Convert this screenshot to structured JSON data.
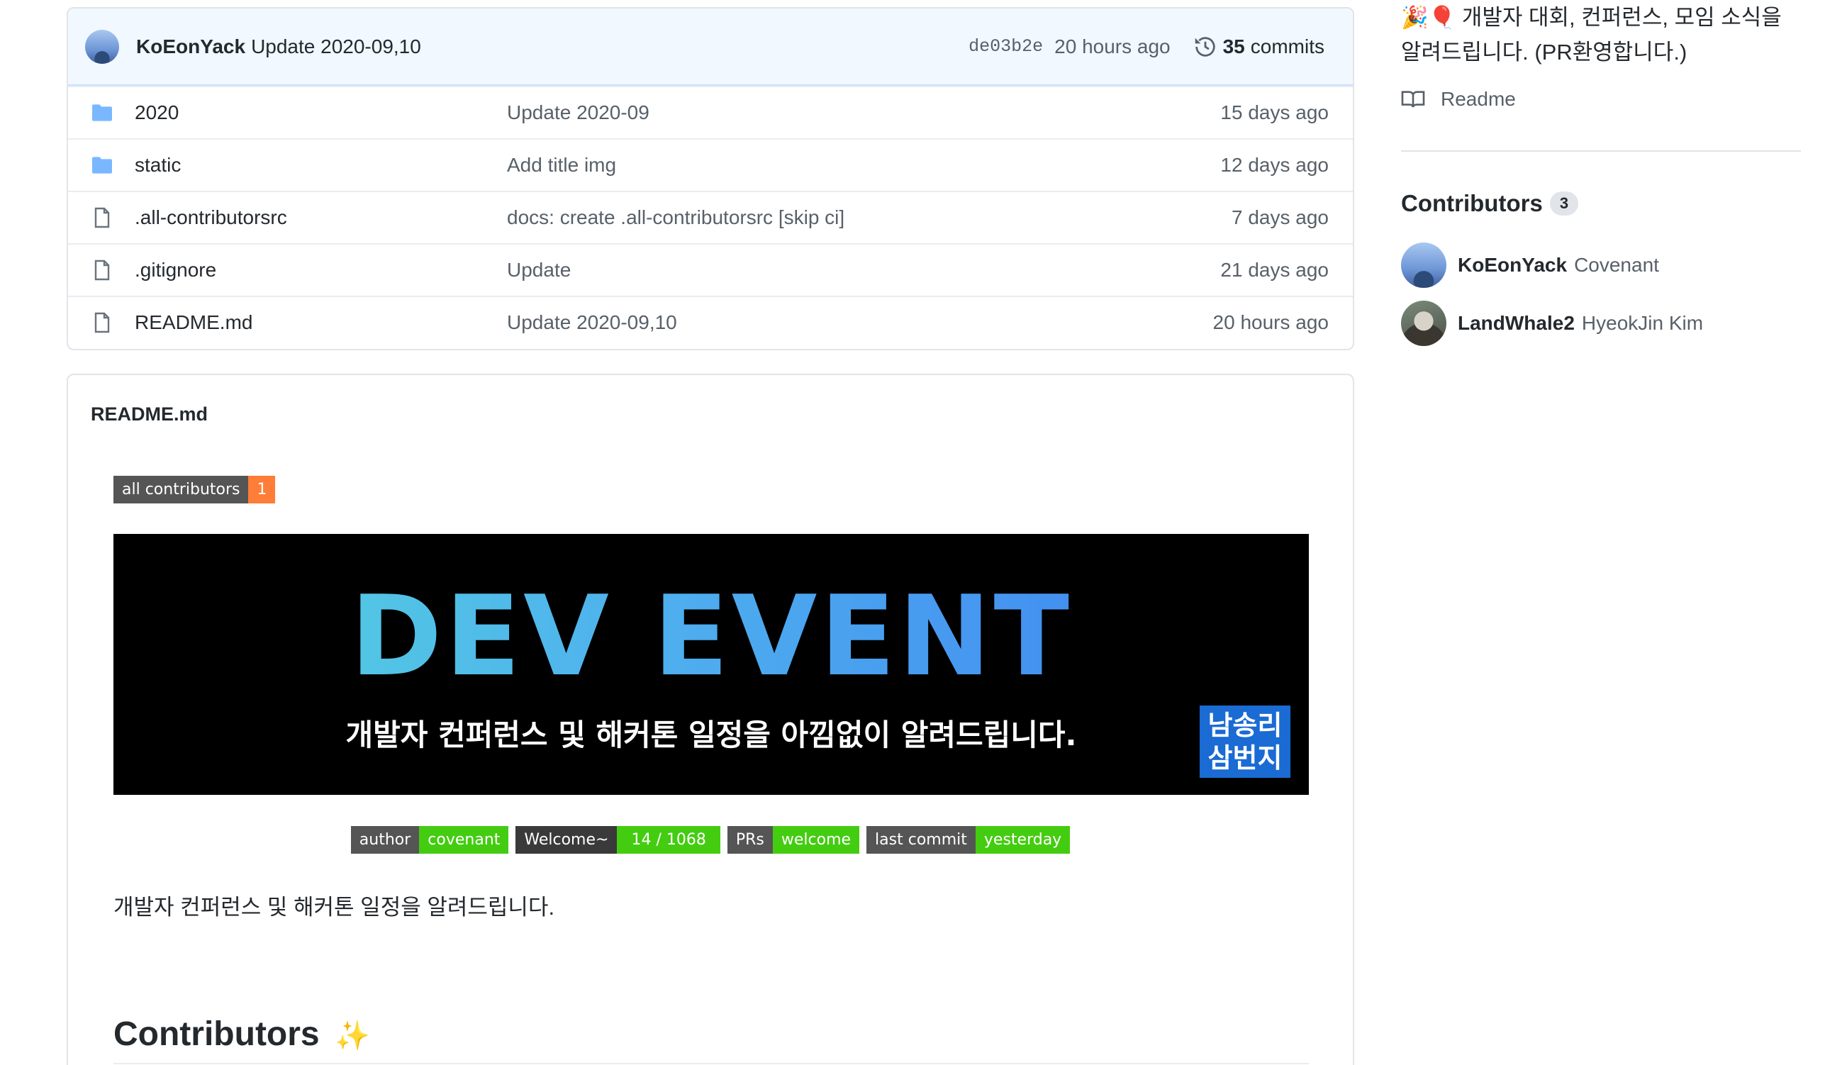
{
  "latest_commit": {
    "author": "KoEonYack",
    "message": "Update 2020-09,10",
    "sha": "de03b2e",
    "time": "20 hours ago",
    "commits_count": "35",
    "commits_label": "commits"
  },
  "files": [
    {
      "type": "folder",
      "name": "2020",
      "commit": "Update 2020-09",
      "age": "15 days ago"
    },
    {
      "type": "folder",
      "name": "static",
      "commit": "Add title img",
      "age": "12 days ago"
    },
    {
      "type": "file",
      "name": ".all-contributorsrc",
      "commit": "docs: create .all-contributorsrc [skip ci]",
      "age": "7 days ago"
    },
    {
      "type": "file",
      "name": ".gitignore",
      "commit": "Update",
      "age": "21 days ago"
    },
    {
      "type": "file",
      "name": "README.md",
      "commit": "Update 2020-09,10",
      "age": "20 hours ago"
    }
  ],
  "readme": {
    "title": "README.md",
    "badge_all_contributors": {
      "label": "all contributors",
      "value": "1",
      "color": "#fe7d37"
    },
    "banner": {
      "title": "DEV EVENT",
      "subtitle": "개발자 컨퍼런스 및 해커톤 일정을 아낌없이 알려드립니다.",
      "logo_line1": "남송리",
      "logo_line2": "삼번지"
    },
    "badges": [
      {
        "label": "author",
        "value": "covenant",
        "color": "#4c1"
      },
      {
        "label": "Welcome~",
        "value": "14 / 1068",
        "color": "#4c1",
        "label_color": "#3a3a3a"
      },
      {
        "label": "PRs",
        "value": "welcome",
        "color": "#4c1"
      },
      {
        "label": "last commit",
        "value": "yesterday",
        "color": "#4c1"
      }
    ],
    "description": "개발자 컨퍼런스 및 해커톤 일정을 알려드립니다.",
    "contributors_heading": "Contributors",
    "sparkle": "✨"
  },
  "sidebar": {
    "about_emoji": "🎉🎈",
    "about_text": "개발자 대회, 컨퍼런스, 모임 소식을 알려드립니다. (PR환영합니다.)",
    "readme_link": "Readme",
    "contributors_title": "Contributors",
    "contributors_count": "3",
    "contributors": [
      {
        "login": "KoEonYack",
        "name": "Covenant"
      },
      {
        "login": "LandWhale2",
        "name": "HyeokJin Kim"
      }
    ]
  },
  "colors": {
    "folder_icon": "#79b8ff",
    "link_blue": "#0366d6",
    "badge_green": "#4c1",
    "badge_orange": "#fe7d37"
  }
}
